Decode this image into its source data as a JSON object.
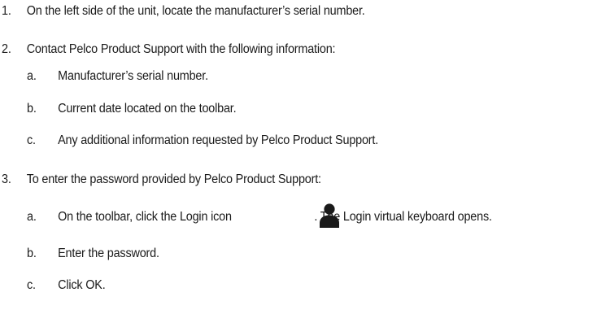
{
  "steps": [
    {
      "number": "1.",
      "text": "On the left side of the unit, locate the manufacturer’s serial number."
    },
    {
      "number": "2.",
      "text": "Contact Pelco Product Support with the following information:",
      "substeps": [
        {
          "letter": "a.",
          "text": "Manufacturer’s serial number."
        },
        {
          "letter": "b.",
          "text": "Current date located on the toolbar."
        },
        {
          "letter": "c.",
          "text": "Any additional information requested by Pelco Product Support."
        }
      ]
    },
    {
      "number": "3.",
      "text": "To enter the password provided by Pelco Product Support:",
      "substeps": [
        {
          "letter": "a.",
          "text_before_icon": "On the toolbar, click the Login icon",
          "icon": "login-person-icon",
          "text_after_icon": ". The Login virtual keyboard opens."
        },
        {
          "letter": "b.",
          "text": "Enter the password."
        },
        {
          "letter": "c.",
          "text": "Click OK."
        }
      ]
    }
  ]
}
